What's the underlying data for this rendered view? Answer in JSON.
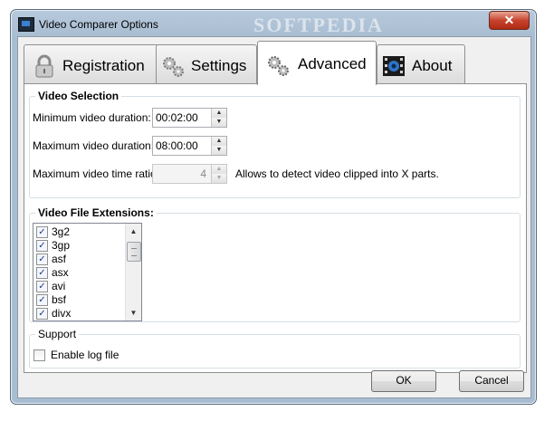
{
  "window": {
    "title": "Video Comparer Options",
    "watermark": "SOFTPEDIA",
    "close_glyph": "✕"
  },
  "tabs": [
    {
      "label": "Registration",
      "icon": "lock-icon",
      "active": false
    },
    {
      "label": "Settings",
      "icon": "gears-icon",
      "active": false
    },
    {
      "label": "Advanced",
      "icon": "gears-icon",
      "active": true
    },
    {
      "label": "About",
      "icon": "film-icon",
      "active": false
    }
  ],
  "video_selection": {
    "title": "Video Selection",
    "min_duration_label": "Minimum video duration:",
    "min_duration_value": "00:02:00",
    "max_duration_label": "Maximum video duration:",
    "max_duration_value": "08:00:00",
    "max_ratio_label": "Maximum video time ratio:",
    "max_ratio_value": "4",
    "max_ratio_hint": "Allows to detect video clipped into X parts."
  },
  "extensions": {
    "title": "Video File Extensions:",
    "items": [
      {
        "label": "3g2",
        "checked": true
      },
      {
        "label": "3gp",
        "checked": true
      },
      {
        "label": "asf",
        "checked": true
      },
      {
        "label": "asx",
        "checked": true
      },
      {
        "label": "avi",
        "checked": true
      },
      {
        "label": "bsf",
        "checked": true
      },
      {
        "label": "divx",
        "checked": true
      }
    ],
    "check_glyph": "✓"
  },
  "support": {
    "title": "Support",
    "enable_log_label": "Enable log file",
    "enable_log_checked": false
  },
  "buttons": {
    "ok": "OK",
    "cancel": "Cancel"
  }
}
